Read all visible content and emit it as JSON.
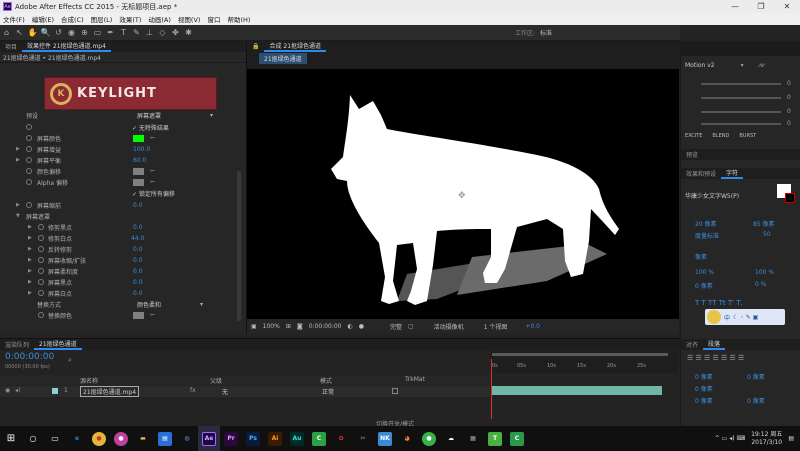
{
  "window": {
    "title": "Adobe After Effects CC 2015 - 无标题项目.aep *",
    "min": "—",
    "max": "❐",
    "close": "✕"
  },
  "menu": [
    "文件(F)",
    "编辑(E)",
    "合成(C)",
    "图层(L)",
    "效果(T)",
    "动画(A)",
    "视图(V)",
    "窗口",
    "帮助(H)"
  ],
  "toolbar": {
    "workspace_label": "工作区:",
    "workspace_value": "标准"
  },
  "effect_panel": {
    "tabs": [
      "项目",
      "效果控件 21抠绿色通道.mp4"
    ],
    "breadcrumb": "21抠绿色通道 • 21抠绿色通道.mp4",
    "logo_text": "KEYLIGHT",
    "rows": [
      {
        "label": "预设",
        "value": "屏幕遮罩",
        "kind": "dropdown"
      },
      {
        "label": "",
        "value": "✓ 无特殊结果",
        "kind": "text"
      },
      {
        "label": "屏幕颜色",
        "value": "",
        "kind": "color",
        "color": "#00ff00"
      },
      {
        "label": "屏幕增益",
        "value": "100.0",
        "kind": "num"
      },
      {
        "label": "屏幕平衡",
        "value": "60.0",
        "kind": "num"
      },
      {
        "label": "颜色偏移",
        "value": "",
        "kind": "color",
        "color": "#808080"
      },
      {
        "label": "Alpha 偏移",
        "value": "",
        "kind": "color",
        "color": "#808080"
      },
      {
        "label": "",
        "value": "✓ 锁定所有偏移",
        "kind": "text"
      },
      {
        "label": "屏幕缩前",
        "value": "0.0",
        "kind": "num"
      },
      {
        "label": "屏幕遮罩",
        "value": "",
        "kind": "header"
      },
      {
        "label": "修剪黑点",
        "value": "0.0",
        "kind": "num"
      },
      {
        "label": "修剪白点",
        "value": "44.0",
        "kind": "num"
      },
      {
        "label": "反转修剪",
        "value": "0.0",
        "kind": "num"
      },
      {
        "label": "屏幕收缩/扩张",
        "value": "0.0",
        "kind": "num"
      },
      {
        "label": "屏幕柔和度",
        "value": "0.0",
        "kind": "num"
      },
      {
        "label": "屏幕黑点",
        "value": "0.0",
        "kind": "num"
      },
      {
        "label": "屏幕白点",
        "value": "0.0",
        "kind": "num"
      },
      {
        "label": "替换方式",
        "value": "颜色柔和",
        "kind": "dropdown"
      },
      {
        "label": "替换颜色",
        "value": "",
        "kind": "color",
        "color": "#808080"
      }
    ]
  },
  "composition": {
    "tab": "合成 21抠绿色通道",
    "subtab": "21抠绿色通道",
    "footer": {
      "zoom": "100%",
      "timecode": "0:00:00:00",
      "mode": "完整",
      "camera": "活动摄像机",
      "views": "1 个视图",
      "offset": "+0.0"
    }
  },
  "right_panel": {
    "motion": "Motion v2",
    "slider_values": [
      "0",
      "0",
      "0",
      "0"
    ],
    "actions": [
      "EXCITE",
      "BLEND",
      "BURST"
    ],
    "tabs": [
      "预览",
      "效果和预设",
      "字符"
    ],
    "font": "华康少女文字W5(P)",
    "char_vals": [
      "20 像素",
      "85 像素",
      "度量标准",
      "50",
      "像素",
      "100 %",
      "100 %",
      "0 像素",
      "0 %"
    ],
    "para_tabs": [
      "对齐",
      "段落"
    ],
    "para_vals": [
      "0 像素",
      "0 像素",
      "0 像素",
      "0 像素",
      "0 像素"
    ]
  },
  "timeline": {
    "tabs": [
      "渲染队列",
      "21抠绿色通道"
    ],
    "timecode": "0:00:00:00",
    "fps": "00000 (30.00 fps)",
    "col_source": "源名称",
    "col_parent": "父级",
    "col_mode": "模式",
    "col_trk": "TrkMat",
    "ticks": [
      "0s",
      "05s",
      "10s",
      "15s",
      "20s",
      "25s"
    ],
    "layer_num": "1",
    "layer_name": "21抠绿色通道.mp4",
    "layer_parent": "无",
    "layer_mode": "正常",
    "footer": "切换开关/模式"
  },
  "taskbar": {
    "time": "19:12 周五",
    "date": "2017/3/10",
    "ime": "中"
  },
  "colors": {
    "accent": "#2d8ceb",
    "ae_purple": "#9999ff",
    "timeline_bar": "#6fb7a6",
    "keylight_red": "#8b2a33"
  }
}
